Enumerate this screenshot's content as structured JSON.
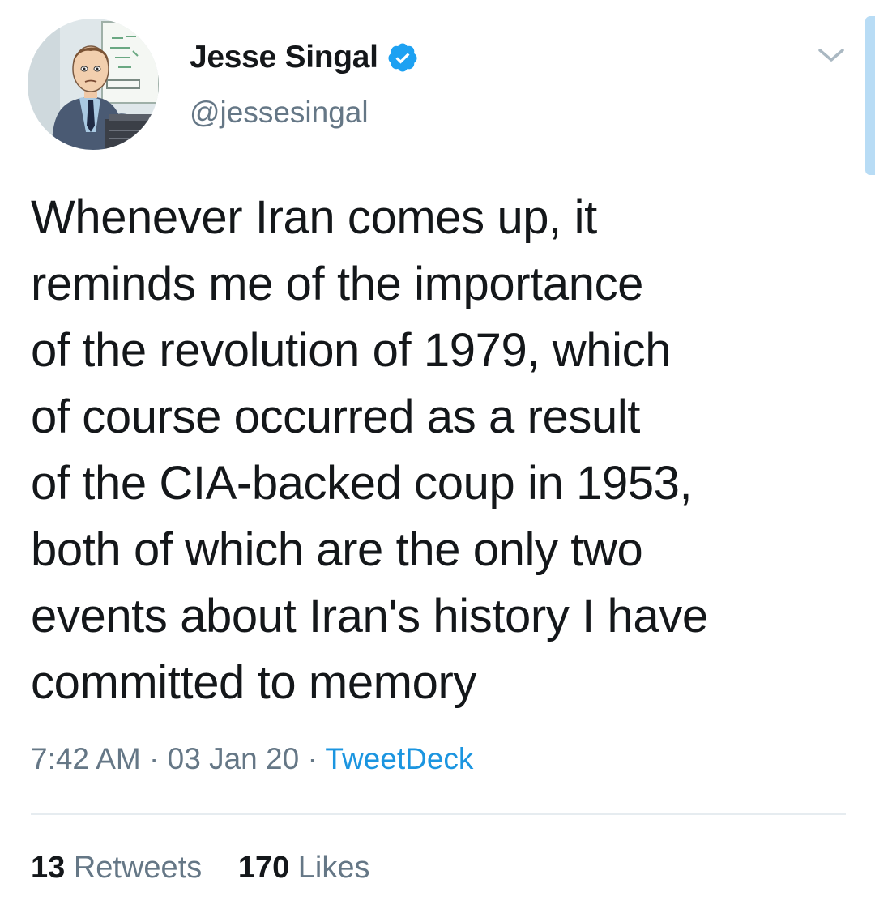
{
  "author": {
    "display_name": "Jesse Singal",
    "handle": "@jessesingal",
    "verified_icon": "verified-badge-icon",
    "avatar_icon": "avatar-cartoon-man-at-desk"
  },
  "tweet": {
    "text": "Whenever Iran comes up, it\nreminds me of the importance\nof the revolution of 1979, which\nof course occurred as a result\nof the CIA-backed coup in 1953,\nboth of which are the only two\nevents about Iran's history I have\ncommitted to memory",
    "time": "7:42 AM",
    "date": "03 Jan 20",
    "separator": " · ",
    "source": "TweetDeck"
  },
  "stats": {
    "retweets_count": "13",
    "retweets_label": "Retweets",
    "likes_count": "170",
    "likes_label": "Likes"
  },
  "icons": {
    "menu": "chevron-down-icon"
  },
  "colors": {
    "text": "#14171a",
    "secondary": "#657786",
    "link": "#1b95e0",
    "verified": "#1da1f2",
    "divider": "#e6ecf0"
  }
}
